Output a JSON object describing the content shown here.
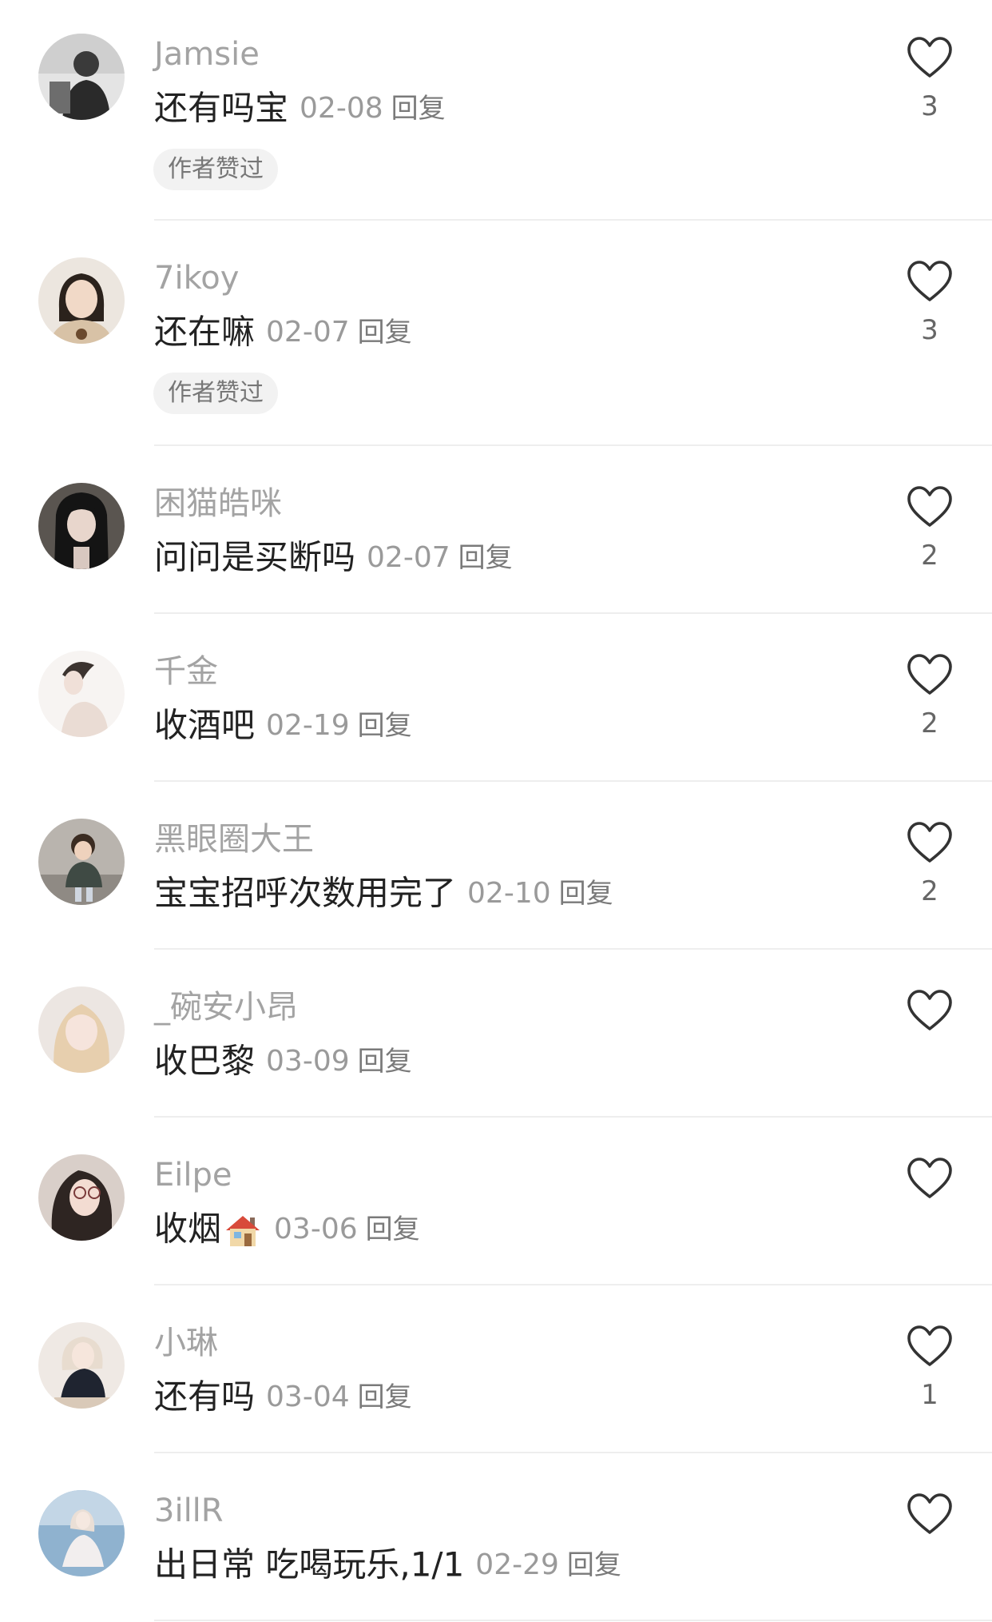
{
  "comments": [
    {
      "username": "Jamsie",
      "content": "还有吗宝",
      "date": "02-08",
      "reply": "回复",
      "badge": "作者赞过",
      "likes": "3"
    },
    {
      "username": "7ikoy",
      "content": "还在嘛",
      "date": "02-07",
      "reply": "回复",
      "badge": "作者赞过",
      "likes": "3"
    },
    {
      "username": "困猫皓咪",
      "content": "问问是买断吗",
      "date": "02-07",
      "reply": "回复",
      "likes": "2"
    },
    {
      "username": "千金",
      "content": "收酒吧",
      "date": "02-19",
      "reply": "回复",
      "likes": "2"
    },
    {
      "username": "黑眼圈大王",
      "content": "宝宝招呼次数用完了",
      "date": "02-10",
      "reply": "回复",
      "likes": "2"
    },
    {
      "username": "_碗安小昂",
      "content": "收巴黎",
      "date": "03-09",
      "reply": "回复",
      "likes": ""
    },
    {
      "username": "Eilpe",
      "content": "收烟",
      "date": "03-06",
      "reply": "回复",
      "likes": "",
      "emoji_icon": "house-emoji"
    },
    {
      "username": "小琳",
      "content": "还有吗",
      "date": "03-04",
      "reply": "回复",
      "likes": "1"
    },
    {
      "username": "3illR",
      "content": "出日常 吃喝玩乐,1/1",
      "date": "02-29",
      "reply": "回复",
      "likes": ""
    }
  ],
  "colors": {
    "username": "#a3a3a3",
    "content": "#222222",
    "date": "#9a9a9a",
    "badge_bg": "#f2f2f2",
    "heart_stroke": "#333333",
    "divider": "#eeeeee"
  },
  "icons": {
    "like": "heart-outline-icon"
  }
}
